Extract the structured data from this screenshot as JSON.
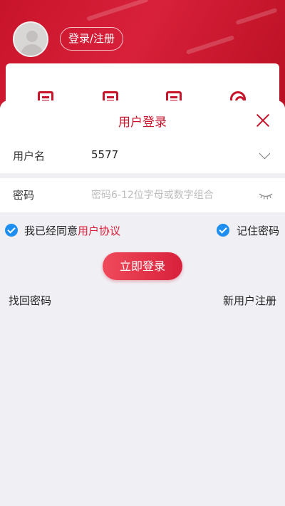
{
  "background": {
    "login_register": "登录/注册"
  },
  "sheet": {
    "title": "用户登录"
  },
  "username": {
    "label": "用户名",
    "value": "5577"
  },
  "password": {
    "label": "密码",
    "placeholder": "密码6-12位字母或数字组合"
  },
  "agreement": {
    "prefix": "我已经同意",
    "link": "用户协议",
    "checked": true
  },
  "remember": {
    "label": "记住密码",
    "checked": true
  },
  "login_button": "立即登录",
  "links": {
    "recover": "找回密码",
    "register": "新用户注册"
  },
  "colors": {
    "brand": "#c8142a",
    "check": "#1f8ef1"
  }
}
